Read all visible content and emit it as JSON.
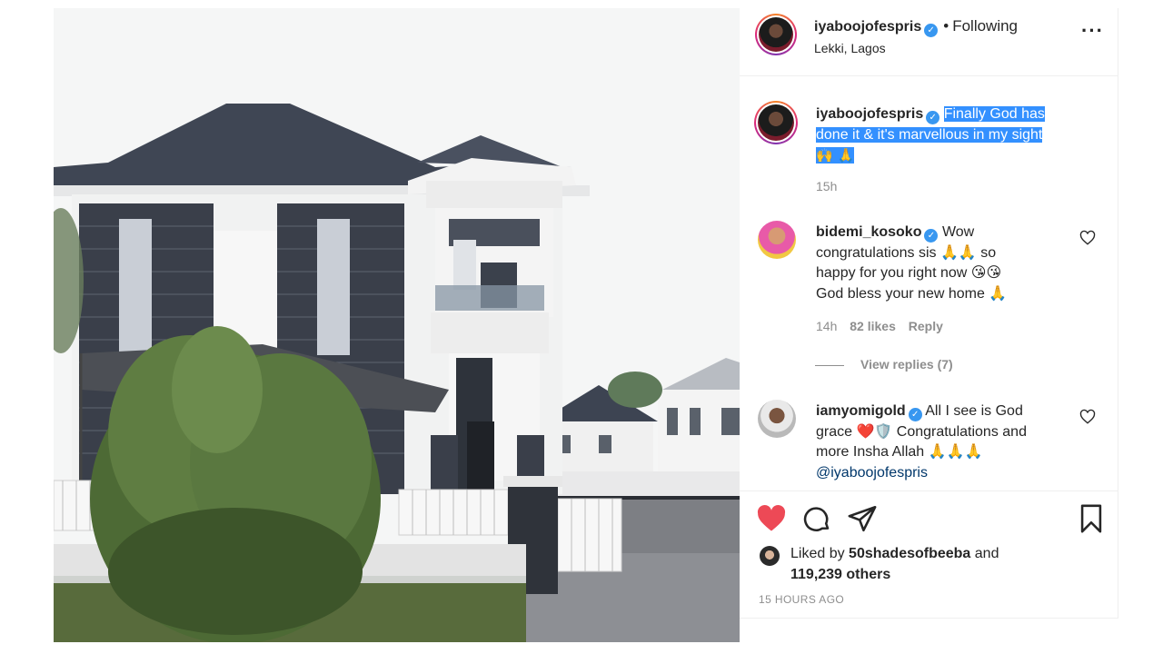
{
  "post": {
    "author": "iyaboojofespris",
    "verified_icon": "verified-badge-icon",
    "dot": "•",
    "follow_status": "Following",
    "location": "Lekki, Lagos",
    "more_icon": "more-options-icon",
    "caption_text_1": "Finally God has",
    "caption_text_2": "done it & it's marvellous in my sight",
    "caption_emoji": "🙌 🙏",
    "caption_time": "15h"
  },
  "comments": [
    {
      "username": "bidemi_kosoko",
      "text_1": "Wow",
      "text_2": "congratulations sis 🙏🙏 so",
      "text_3": "happy for you right now 😘😘",
      "text_4": "God bless your new home 🙏",
      "time": "14h",
      "likes": "82 likes",
      "reply": "Reply",
      "view_replies": "View replies (7)"
    },
    {
      "username": "iamyomigold",
      "text_1": "All I see is God",
      "text_2": "grace ❤️🛡️ Congratulations and",
      "text_3": "more Insha Allah 🙏🙏🙏",
      "mention": "@iyaboojofespris"
    }
  ],
  "actions": {
    "like_icon": "heart-filled-icon",
    "comment_icon": "comment-icon",
    "share_icon": "share-icon",
    "save_icon": "bookmark-icon",
    "liked_by_prefix": "Liked by",
    "liked_by_user": "50shadesofbeeba",
    "liked_by_and": "and",
    "liked_by_others": "119,239 others",
    "timestamp": "15 HOURS AGO"
  },
  "colors": {
    "like_red": "#ed4956",
    "link_blue": "#00376b",
    "verified_blue": "#3897f0",
    "selection_blue": "#3390ff",
    "muted_gray": "#8e8e8e"
  }
}
